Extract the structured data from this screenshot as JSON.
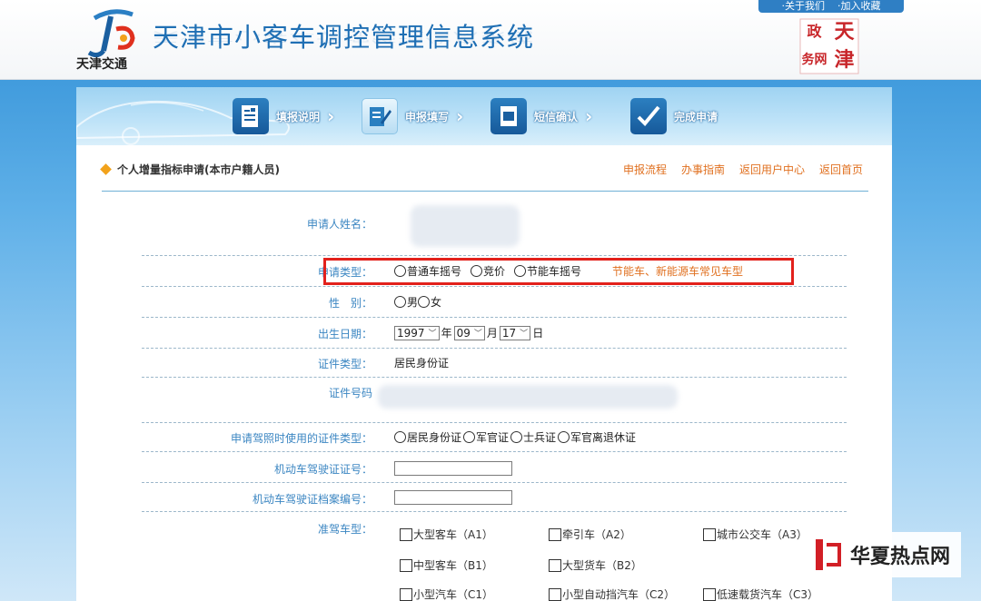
{
  "header": {
    "logo_caption": "天津交通",
    "title": "天津市小客车调控管理信息系统",
    "toplinks": [
      "·关于我们",
      "·加入收藏"
    ],
    "seal_chars": [
      "天",
      "津",
      "政",
      "务网"
    ]
  },
  "steps": [
    {
      "label": "填报说明",
      "icon": "document-list-icon"
    },
    {
      "label": "申报填写",
      "icon": "pen-form-icon"
    },
    {
      "label": "短信确认",
      "icon": "phone-sms-icon"
    },
    {
      "label": "完成申请",
      "icon": "checkmark-icon"
    }
  ],
  "section": {
    "title": "个人增量指标申请(本市户籍人员)",
    "links": [
      "申报流程",
      "办事指南",
      "返回用户中心",
      "返回首页"
    ]
  },
  "form": {
    "name_label": "申请人姓名：",
    "type_label": "申请类型：",
    "type_options": [
      "普通车摇号",
      "竞价",
      "节能车摇号"
    ],
    "type_hint": "节能车、新能源车常见车型",
    "gender_label": "性　别：",
    "gender_options": [
      "男",
      "女"
    ],
    "birth_label": "出生日期：",
    "birth_year": "1997",
    "birth_year_unit": "年",
    "birth_month": "09",
    "birth_month_unit": "月",
    "birth_day": "17",
    "birth_day_unit": "日",
    "id_type_label": "证件类型：",
    "id_type_value": "居民身份证",
    "id_number_label": "证件号码",
    "license_id_type_label": "申请驾照时使用的证件类型：",
    "license_id_type_options": [
      "居民身份证",
      "军官证",
      "士兵证",
      "军官离退休证"
    ],
    "license_number_label": "机动车驾驶证证号：",
    "license_file_label": "机动车驾驶证档案编号：",
    "license_class_label": "准驾车型：",
    "license_classes": [
      [
        "大型客车（A1）",
        "牵引车（A2）",
        "城市公交车（A3）"
      ],
      [
        "中型客车（B1）",
        "大型货车（B2）"
      ],
      [
        "小型汽车（C1）",
        "小型自动挡汽车（C2）",
        "低速载货汽车（C3）"
      ]
    ]
  },
  "watermark": "华夏热点网"
}
